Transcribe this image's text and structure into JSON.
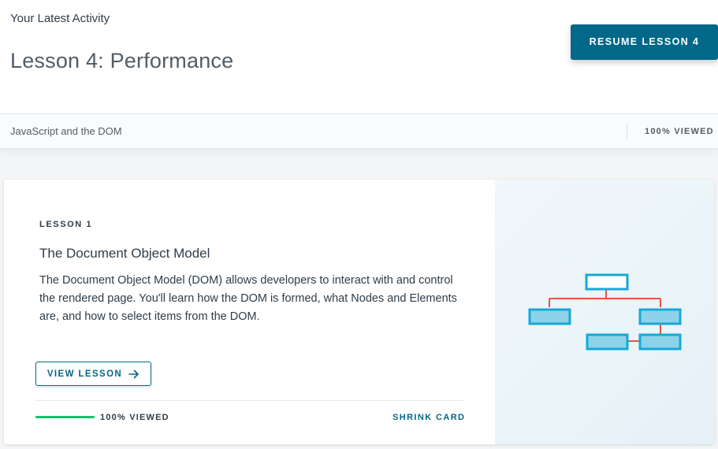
{
  "header": {
    "activity_label": "Your Latest Activity",
    "lesson_title": "Lesson 4: Performance",
    "resume_button": "RESUME LESSON 4"
  },
  "course": {
    "name": "JavaScript and the DOM",
    "viewed": "100% VIEWED"
  },
  "card": {
    "lesson_number": "LESSON 1",
    "title": "The Document Object Model",
    "description": "The Document Object Model (DOM) allows developers to interact with and control the rendered page. You'll learn how the DOM is formed, what Nodes and Elements are, and how to select items from the DOM.",
    "view_button": "VIEW LESSON",
    "progress_fraction": 1.0,
    "progress_label": "100% VIEWED",
    "shrink_link": "SHRINK CARD",
    "illustration": "dom-tree-diagram"
  },
  "colors": {
    "accent": "#02688a",
    "progress": "#15c26b",
    "node_fill": "#8ed2ea",
    "node_stroke": "#17a8d8",
    "connector": "#e8533f"
  },
  "icons": {
    "view_arrow": "arrow-right-icon"
  }
}
